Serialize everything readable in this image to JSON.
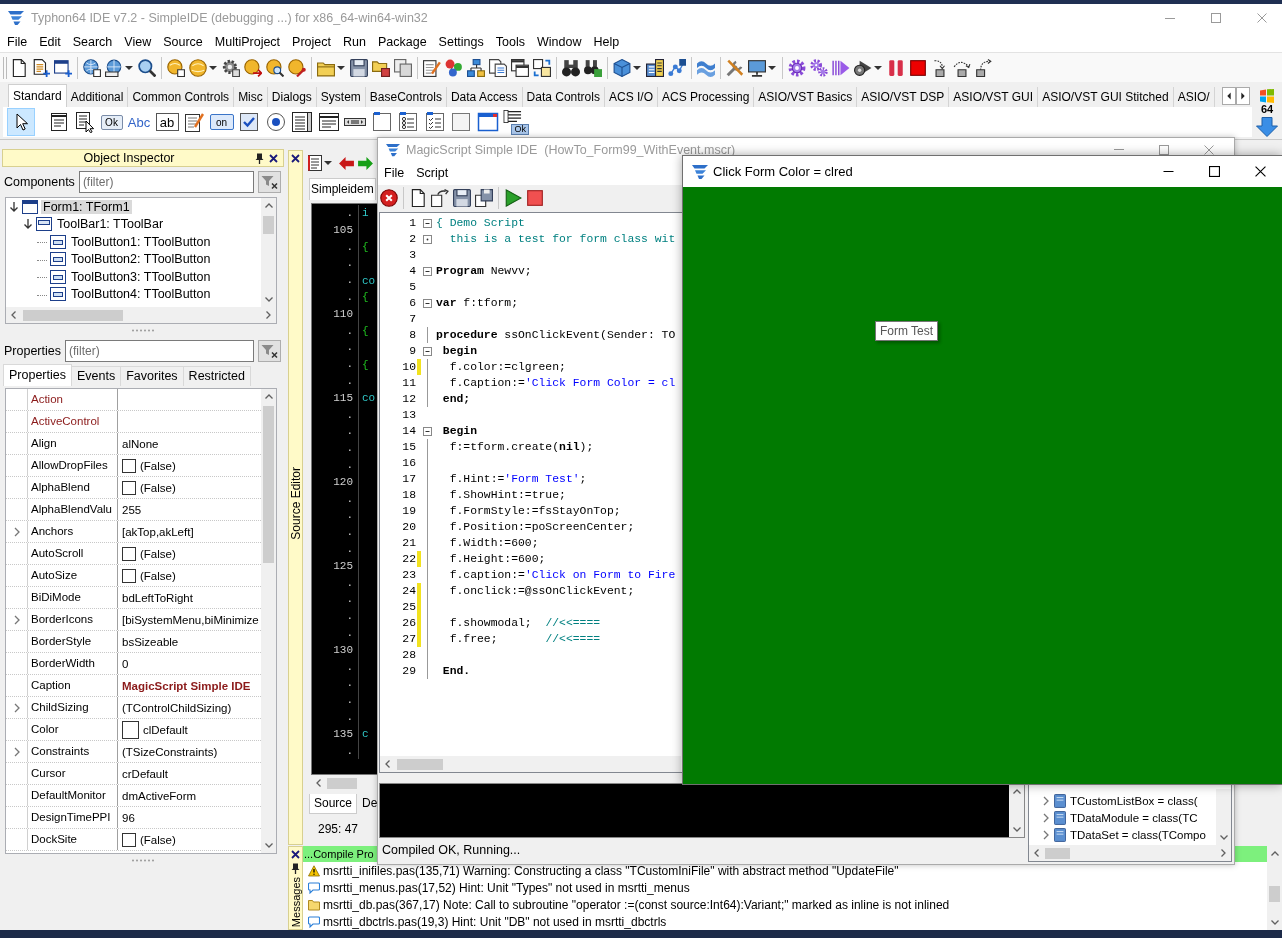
{
  "main_window": {
    "title": "Typhon64 IDE v7.2 - SimpleIDE (debugging ...) for x86_64-win64-win32",
    "active": false,
    "menu": [
      "File",
      "Edit",
      "Search",
      "View",
      "Source",
      "MultiProject",
      "Project",
      "Run",
      "Package",
      "Settings",
      "Tools",
      "Window",
      "Help"
    ]
  },
  "palette": {
    "tabs": [
      {
        "label": "Standard",
        "selected": true
      },
      {
        "label": "Additional",
        "selected": false
      },
      {
        "label": "Common Controls",
        "selected": false
      },
      {
        "label": "Misc",
        "selected": false
      },
      {
        "label": "Dialogs",
        "selected": false
      },
      {
        "label": "System",
        "selected": false
      },
      {
        "label": "BaseControls",
        "selected": false
      },
      {
        "label": "Data Access",
        "selected": false
      },
      {
        "label": "Data Controls",
        "selected": false
      },
      {
        "label": "ACS I/O",
        "selected": false
      },
      {
        "label": "ACS Processing",
        "selected": false
      },
      {
        "label": "ASIO/VST Basics",
        "selected": false
      },
      {
        "label": "ASIO/VST DSP",
        "selected": false
      },
      {
        "label": "ASIO/VST GUI",
        "selected": false
      },
      {
        "label": "ASIO/VST GUI Stitched",
        "selected": false
      },
      {
        "label": "ASIO/",
        "selected": false
      }
    ],
    "items": [
      {
        "kind": "pointer",
        "selected": true
      },
      {
        "kind": "mainmenu",
        "selected": false
      },
      {
        "kind": "popupmenu",
        "selected": false
      },
      {
        "kind": "button",
        "text": "Ok",
        "selected": false
      },
      {
        "kind": "label",
        "text": "Abc",
        "selected": false
      },
      {
        "kind": "edit",
        "text": "ab",
        "selected": false
      },
      {
        "kind": "memo",
        "selected": false
      },
      {
        "kind": "toggle",
        "text": "on",
        "selected": false
      },
      {
        "kind": "checkbox",
        "selected": false
      },
      {
        "kind": "radio",
        "selected": false
      },
      {
        "kind": "listbox",
        "selected": false
      },
      {
        "kind": "combobox",
        "selected": false
      },
      {
        "kind": "scrollbar",
        "selected": false
      },
      {
        "kind": "groupbox",
        "selected": false
      },
      {
        "kind": "radiogroup",
        "selected": false
      },
      {
        "kind": "checkgroup",
        "selected": false
      },
      {
        "kind": "panel",
        "selected": false
      },
      {
        "kind": "frame",
        "selected": false
      },
      {
        "kind": "actionlist",
        "text": "Ok",
        "selected": false
      }
    ],
    "badge": "64"
  },
  "object_inspector": {
    "title": "Object Inspector",
    "components_label": "Components",
    "components_filter": {
      "placeholder": "(filter)"
    },
    "tree": [
      {
        "label": "Form1: TForm1",
        "selected": true,
        "expanded": true,
        "children": [
          {
            "label": "ToolBar1: TToolBar",
            "selected": false,
            "expanded": true,
            "children": [
              {
                "label": "ToolButton1: TToolButton",
                "selected": false
              },
              {
                "label": "ToolButton2: TToolButton",
                "selected": false
              },
              {
                "label": "ToolButton3: TToolButton",
                "selected": false
              },
              {
                "label": "ToolButton4: TToolButton",
                "selected": false
              }
            ]
          }
        ]
      }
    ],
    "properties_label": "Properties",
    "properties_filter": {
      "placeholder": "(filter)"
    },
    "tabs": [
      {
        "label": "Properties",
        "selected": true
      },
      {
        "label": "Events",
        "selected": false
      },
      {
        "label": "Favorites",
        "selected": false
      },
      {
        "label": "Restricted",
        "selected": false
      }
    ],
    "properties": [
      {
        "name": "Action",
        "kind": "text",
        "expandable": false,
        "reference": true
      },
      {
        "name": "ActiveControl",
        "kind": "text",
        "expandable": false,
        "reference": true
      },
      {
        "name": "Align",
        "kind": "text",
        "value": "alNone",
        "expandable": false,
        "reference": false,
        "modified": false
      },
      {
        "name": "AllowDropFiles",
        "kind": "check",
        "checked": false,
        "value": "(False)",
        "expandable": false,
        "reference": false,
        "modified": false
      },
      {
        "name": "AlphaBlend",
        "kind": "check",
        "checked": false,
        "value": "(False)",
        "expandable": false,
        "reference": false,
        "modified": false
      },
      {
        "name": "AlphaBlendValu",
        "kind": "text",
        "value": "255",
        "expandable": false,
        "reference": false,
        "modified": false
      },
      {
        "name": "Anchors",
        "kind": "text",
        "value": "[akTop,akLeft]",
        "expandable": true,
        "reference": false,
        "modified": false
      },
      {
        "name": "AutoScroll",
        "kind": "check",
        "checked": false,
        "value": "(False)",
        "expandable": false,
        "reference": false,
        "modified": false
      },
      {
        "name": "AutoSize",
        "kind": "check",
        "checked": false,
        "value": "(False)",
        "expandable": false,
        "reference": false,
        "modified": false
      },
      {
        "name": "BiDiMode",
        "kind": "text",
        "value": "bdLeftToRight",
        "expandable": false,
        "reference": false,
        "modified": false
      },
      {
        "name": "BorderIcons",
        "kind": "text",
        "value": "[biSystemMenu,biMinimize",
        "expandable": true,
        "reference": false,
        "modified": false
      },
      {
        "name": "BorderStyle",
        "kind": "text",
        "value": "bsSizeable",
        "expandable": false,
        "reference": false,
        "modified": false
      },
      {
        "name": "BorderWidth",
        "kind": "text",
        "value": "0",
        "expandable": false,
        "reference": false,
        "modified": false
      },
      {
        "name": "Caption",
        "kind": "text",
        "value": "MagicScript Simple IDE",
        "expandable": false,
        "reference": false,
        "modified": true
      },
      {
        "name": "ChildSizing",
        "kind": "text",
        "value": "(TControlChildSizing)",
        "expandable": true,
        "reference": false,
        "modified": false
      },
      {
        "name": "Color",
        "kind": "color",
        "value": "clDefault",
        "expandable": false,
        "reference": false,
        "modified": false
      },
      {
        "name": "Constraints",
        "kind": "text",
        "value": "(TSizeConstraints)",
        "expandable": true,
        "reference": false,
        "modified": false
      },
      {
        "name": "Cursor",
        "kind": "text",
        "value": "crDefault",
        "expandable": false,
        "reference": false,
        "modified": false
      },
      {
        "name": "DefaultMonitor",
        "kind": "text",
        "value": "dmActiveForm",
        "expandable": false,
        "reference": false,
        "modified": false
      },
      {
        "name": "DesignTimePPI",
        "kind": "text",
        "value": "96",
        "expandable": false,
        "reference": false,
        "modified": false
      },
      {
        "name": "DockSite",
        "kind": "check",
        "checked": false,
        "value": "(False)",
        "expandable": false,
        "reference": false,
        "modified": false
      }
    ]
  },
  "source_editor": {
    "dock_label": "Source Editor",
    "tab": "Simpleidem",
    "lines": [
      {
        "gutter": ".",
        "code": "i",
        "kind": "code"
      },
      {
        "gutter": "105"
      },
      {
        "gutter": ".",
        "code": "{",
        "kind": "comment"
      },
      {
        "gutter": "."
      },
      {
        "gutter": ".",
        "code": "co",
        "kind": "code"
      },
      {
        "gutter": ".",
        "code": "{",
        "kind": "comment"
      },
      {
        "gutter": "110"
      },
      {
        "gutter": ".",
        "code": "{",
        "kind": "comment"
      },
      {
        "gutter": "."
      },
      {
        "gutter": ".",
        "code": "{",
        "kind": "comment"
      },
      {
        "gutter": "."
      },
      {
        "gutter": "115",
        "code": "co",
        "kind": "code"
      },
      {
        "gutter": "."
      },
      {
        "gutter": "."
      },
      {
        "gutter": "."
      },
      {
        "gutter": "."
      },
      {
        "gutter": "120"
      },
      {
        "gutter": "."
      },
      {
        "gutter": "."
      },
      {
        "gutter": "."
      },
      {
        "gutter": "."
      },
      {
        "gutter": "125"
      },
      {
        "gutter": "."
      },
      {
        "gutter": "."
      },
      {
        "gutter": "."
      },
      {
        "gutter": "."
      },
      {
        "gutter": "130"
      },
      {
        "gutter": "."
      },
      {
        "gutter": "."
      },
      {
        "gutter": "."
      },
      {
        "gutter": "."
      },
      {
        "gutter": "135",
        "code": "c",
        "kind": "code"
      },
      {
        "gutter": "."
      }
    ],
    "bottom_tabs": [
      {
        "label": "Source",
        "selected": true
      },
      {
        "label": "De",
        "selected": false
      }
    ],
    "status": "295: 47"
  },
  "script_window": {
    "title": "MagicScript Simple IDE  (HowTo_Form99_WithEvent.mscr)",
    "active": false,
    "menu": [
      "File",
      "Script"
    ],
    "lines": [
      {
        "number": "1",
        "kind": "fold_start",
        "changed": false,
        "tokens": [
          {
            "text": "{ Demo Script",
            "kind": "comment"
          }
        ]
      },
      {
        "number": "2",
        "kind": "fold_end",
        "changed": false,
        "tokens": [
          {
            "text": "  this is a test for form class wit",
            "kind": "comment"
          }
        ]
      },
      {
        "number": "3",
        "kind": "plain",
        "changed": false
      },
      {
        "number": "4",
        "kind": "fold_start",
        "changed": false,
        "tokens": [
          {
            "text": "Program",
            "kind": "keyword"
          },
          {
            "text": " Newvv;",
            "kind": "plain"
          }
        ]
      },
      {
        "number": "5",
        "kind": "plain",
        "changed": false
      },
      {
        "number": "6",
        "kind": "fold_start",
        "changed": false,
        "tokens": [
          {
            "text": "var",
            "kind": "keyword"
          },
          {
            "text": " f:tform;",
            "kind": "plain"
          }
        ]
      },
      {
        "number": "7",
        "kind": "plain",
        "changed": false
      },
      {
        "number": "8",
        "kind": "block",
        "changed": false,
        "tokens": [
          {
            "text": "procedure",
            "kind": "keyword"
          },
          {
            "text": " ssOnClickEvent(Sender: TO",
            "kind": "plain"
          }
        ]
      },
      {
        "number": "9",
        "kind": "fold_start",
        "changed": false,
        "tokens": [
          {
            "text": " begin",
            "kind": "keyword"
          }
        ]
      },
      {
        "number": "10",
        "kind": "block",
        "changed": true,
        "tokens": [
          {
            "text": "  f.color:=clgreen;",
            "kind": "plain"
          }
        ]
      },
      {
        "number": "11",
        "kind": "block",
        "changed": false,
        "tokens": [
          {
            "text": "  f.Caption:=",
            "kind": "plain"
          },
          {
            "text": "'Click Form Color = cl",
            "kind": "string"
          }
        ]
      },
      {
        "number": "12",
        "kind": "block",
        "changed": false,
        "tokens": [
          {
            "text": " end;",
            "kind": "keyword"
          }
        ]
      },
      {
        "number": "13",
        "kind": "plain",
        "changed": false
      },
      {
        "number": "14",
        "kind": "fold_start",
        "changed": false,
        "tokens": [
          {
            "text": " Begin",
            "kind": "keyword"
          }
        ]
      },
      {
        "number": "15",
        "kind": "block",
        "changed": false,
        "tokens": [
          {
            "text": "  f:=tform.create(",
            "kind": "plain"
          },
          {
            "text": "nil",
            "kind": "keyword"
          },
          {
            "text": ");",
            "kind": "plain"
          }
        ]
      },
      {
        "number": "16",
        "kind": "block",
        "changed": false
      },
      {
        "number": "17",
        "kind": "block",
        "changed": false,
        "tokens": [
          {
            "text": "  f.Hint:=",
            "kind": "plain"
          },
          {
            "text": "'Form Test'",
            "kind": "string"
          },
          {
            "text": ";",
            "kind": "plain"
          }
        ]
      },
      {
        "number": "18",
        "kind": "block",
        "changed": false,
        "tokens": [
          {
            "text": "  f.ShowHint:=true;",
            "kind": "plain"
          }
        ]
      },
      {
        "number": "19",
        "kind": "block",
        "changed": false,
        "tokens": [
          {
            "text": "  f.FormStyle:=fsStayOnTop;",
            "kind": "plain"
          }
        ]
      },
      {
        "number": "20",
        "kind": "block",
        "changed": false,
        "tokens": [
          {
            "text": "  f.Position:=poScreenCenter;",
            "kind": "plain"
          }
        ]
      },
      {
        "number": "21",
        "kind": "block",
        "changed": false,
        "tokens": [
          {
            "text": "  f.Width:=600;",
            "kind": "plain"
          }
        ]
      },
      {
        "number": "22",
        "kind": "block",
        "changed": true,
        "tokens": [
          {
            "text": "  f.Height:=600;",
            "kind": "plain"
          }
        ]
      },
      {
        "number": "23",
        "kind": "block",
        "changed": false,
        "tokens": [
          {
            "text": "  f.caption:=",
            "kind": "plain"
          },
          {
            "text": "'Click on Form to Fire",
            "kind": "string"
          }
        ]
      },
      {
        "number": "24",
        "kind": "block",
        "changed": true,
        "tokens": [
          {
            "text": "  f.onclick:=@ssOnClickEvent;",
            "kind": "plain"
          }
        ]
      },
      {
        "number": "25",
        "kind": "block",
        "changed": true
      },
      {
        "number": "26",
        "kind": "block",
        "changed": true,
        "tokens": [
          {
            "text": "  f.showmodal;  ",
            "kind": "plain"
          },
          {
            "text": "//<<====",
            "kind": "comment"
          }
        ]
      },
      {
        "number": "27",
        "kind": "block",
        "changed": true,
        "tokens": [
          {
            "text": "  f.free;       ",
            "kind": "plain"
          },
          {
            "text": "//<<====",
            "kind": "comment"
          }
        ]
      },
      {
        "number": "28",
        "kind": "block",
        "changed": false
      },
      {
        "number": "29",
        "kind": "block",
        "changed": false,
        "tokens": [
          {
            "text": " End.",
            "kind": "keyword"
          }
        ]
      }
    ],
    "status": "Compiled OK, Running...",
    "class_tree": [
      {
        "label": "TCustomListBox = class(",
        "expanded": false
      },
      {
        "label": "TDataModule = class(TC",
        "expanded": false
      },
      {
        "label": "TDataSet = class(TCompo",
        "expanded": false
      }
    ]
  },
  "form_window": {
    "title": "Click Form Color = clred",
    "active": true,
    "tooltip": "Form Test"
  },
  "messages": {
    "dock_label": "Messages",
    "header": "...Compile Pro",
    "items": [
      {
        "kind": "warning",
        "text": "msrtti_inifiles.pas(135,71) Warning: Constructing a class \"TCustomIniFile\" with abstract method \"UpdateFile\""
      },
      {
        "kind": "hint",
        "text": "msrtti_menus.pas(17,52) Hint: Unit \"Types\" not used in msrtti_menus"
      },
      {
        "kind": "note",
        "text": "msrtti_db.pas(367,17) Note: Call to subroutine \"operator :=(const source:Int64):Variant;\" marked as inline is not inlined"
      },
      {
        "kind": "hint",
        "text": "msrtti_dbctrls.pas(19,3) Hint: Unit \"DB\" not used in msrtti_dbctrls"
      }
    ]
  }
}
